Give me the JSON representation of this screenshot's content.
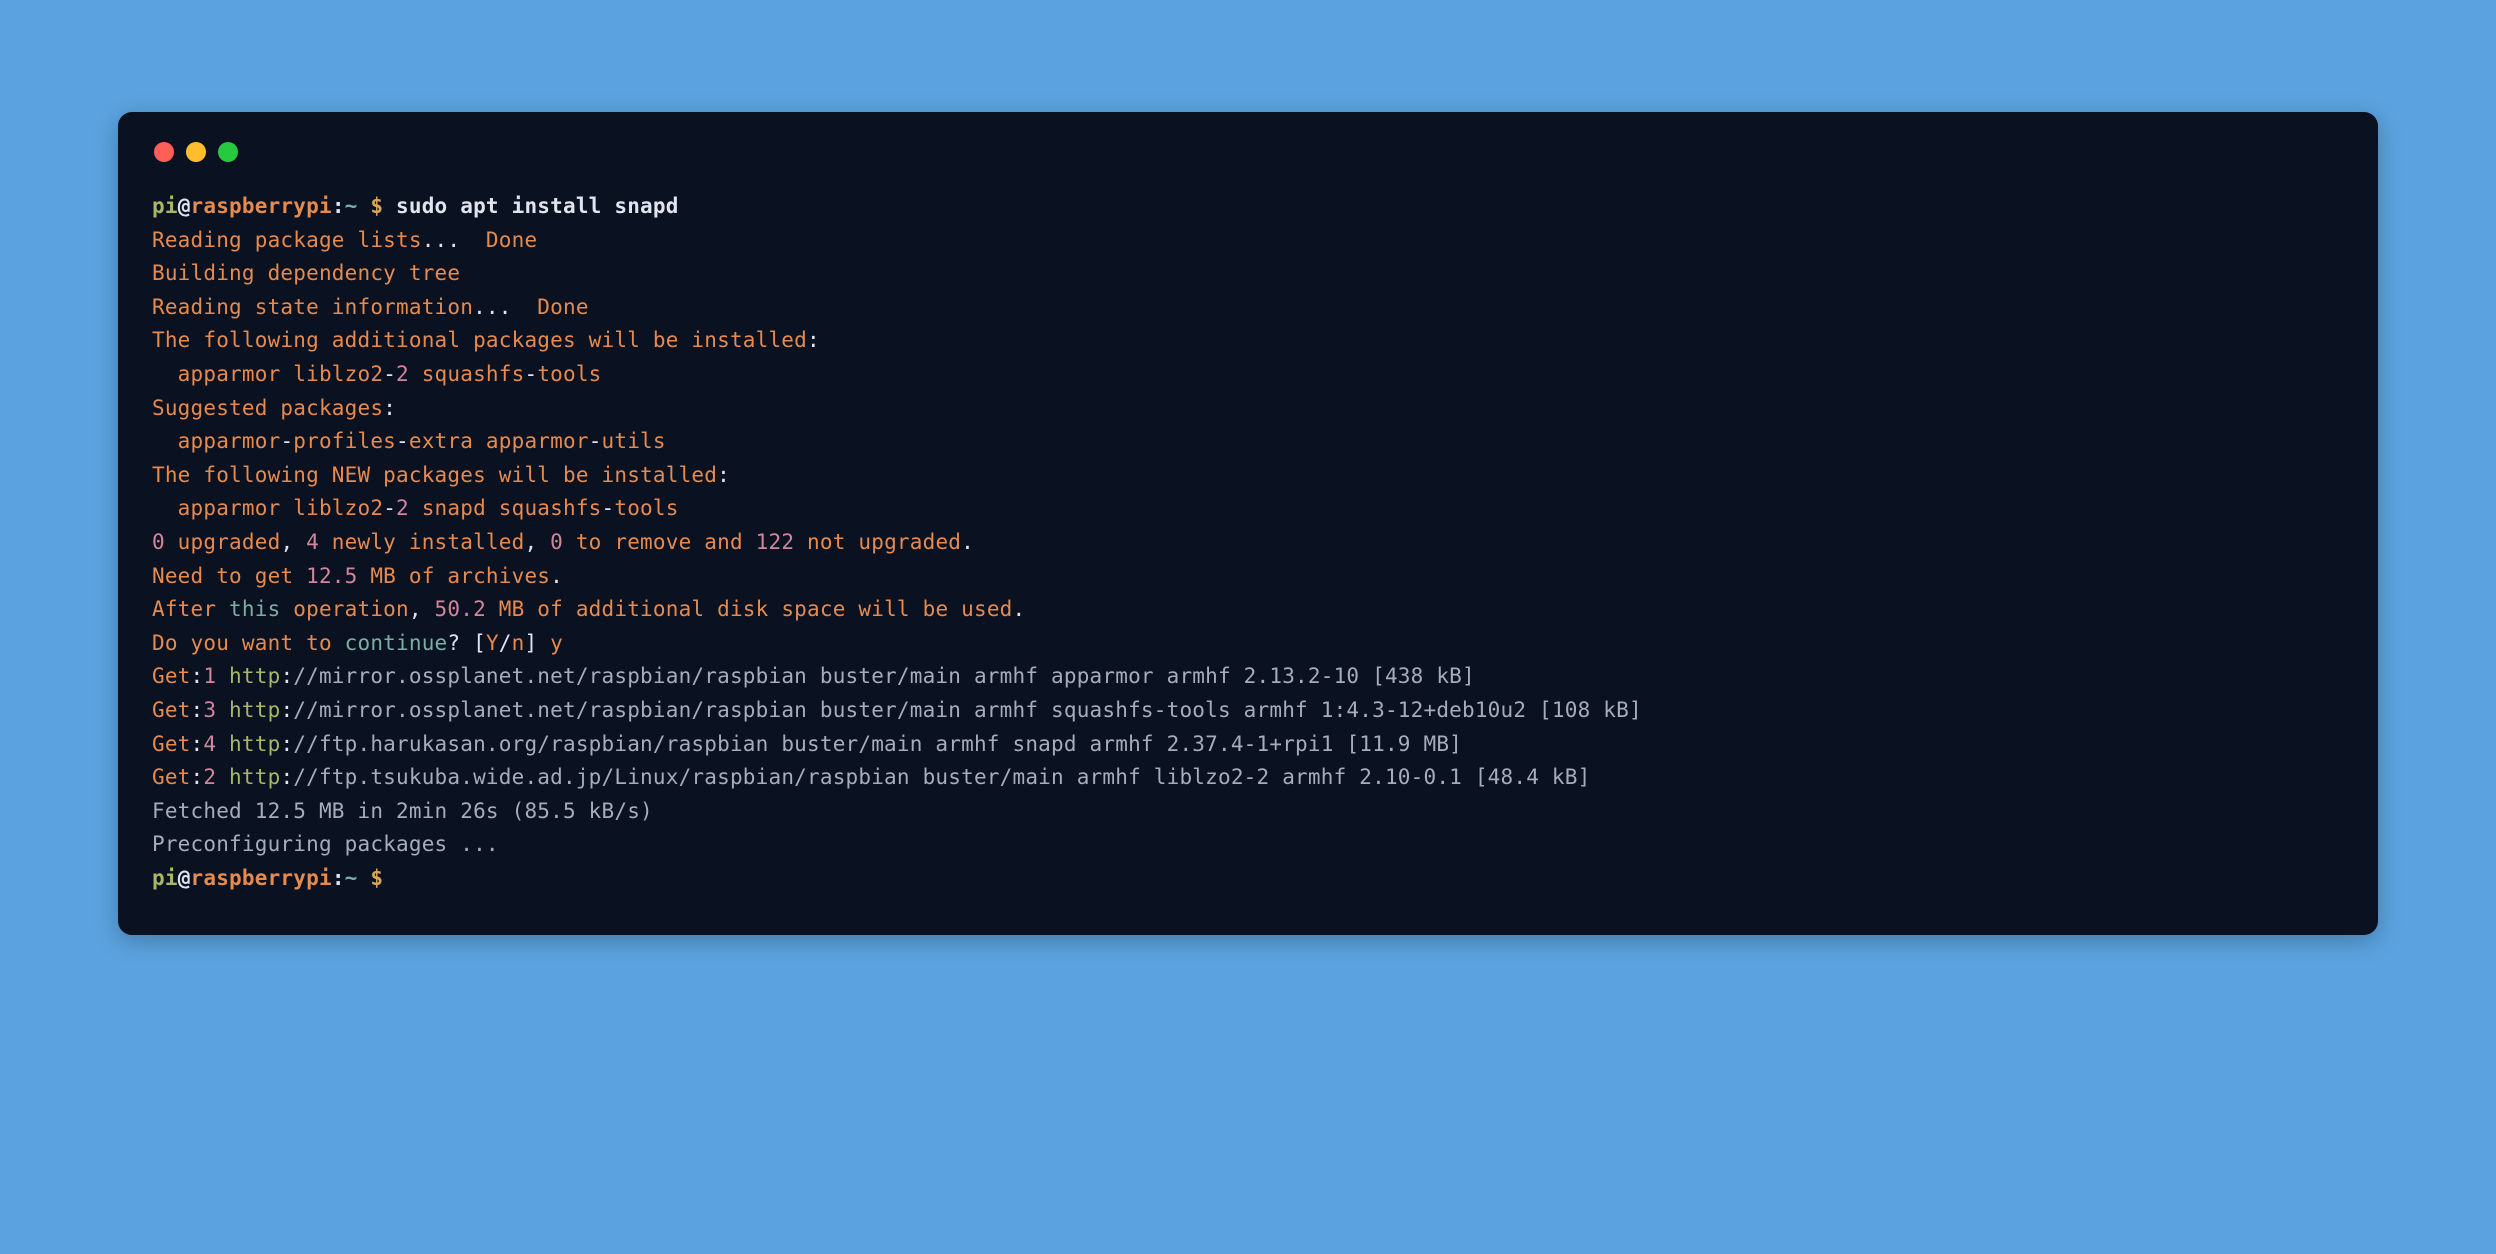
{
  "prompt": {
    "user": "pi",
    "at": "@",
    "host": "raspberrypi",
    "colon": ":",
    "path": "~",
    "symbol": "$"
  },
  "command": "sudo apt install snapd",
  "lines": {
    "l1a": "Reading package lists",
    "l1b": "...",
    "l1c": "  Done",
    "l2": "Building dependency tree",
    "l3a": "Reading state information",
    "l3b": "...",
    "l3c": "  Done",
    "l4a": "The following additional packages will be installed",
    "l4b": ":",
    "l5a": "  apparmor liblzo2",
    "l5m": "-",
    "l5b": "2",
    "l5c": " squashfs",
    "l5d": "-",
    "l5e": "tools",
    "l6a": "Suggested packages",
    "l6b": ":",
    "l7a": "  apparmor",
    "l7b": "-",
    "l7c": "profiles",
    "l7d": "-",
    "l7e": "extra apparmor",
    "l7f": "-",
    "l7g": "utils",
    "l8a": "The following NEW packages will be installed",
    "l8b": ":",
    "l9a": "  apparmor liblzo2",
    "l9m": "-",
    "l9b": "2",
    "l9c": " snapd squashfs",
    "l9d": "-",
    "l9e": "tools",
    "l10a": "0",
    "l10b": " upgraded",
    "l10c": ",",
    "l10d": " 4",
    "l10e": " newly installed",
    "l10f": ",",
    "l10g": " 0",
    "l10h": " to remove and",
    "l10i": " 122",
    "l10j": " not upgraded",
    "l10k": ".",
    "l11a": "Need",
    "l11b": " to get",
    "l11c": " 12.5",
    "l11d": " MB of archives",
    "l11e": ".",
    "l12a": "After",
    "l12b": " this",
    "l12c": " operation",
    "l12d": ",",
    "l12e": " 50.2",
    "l12f": " MB of additional disk space will be used",
    "l12g": ".",
    "l13a": "Do",
    "l13b": " you want to",
    "l13c": " continue",
    "l13d": "?",
    "l13e": " [",
    "l13f": "Y",
    "l13g": "/",
    "l13h": "n",
    "l13i": "]",
    "l13j": " y",
    "g1a": "Get",
    "g1b": ":",
    "g1c": "1",
    "g1d": " http",
    "g1e": ":",
    "g1f": "//mirror.ossplanet.net/raspbian/raspbian buster/main armhf apparmor armhf 2.13.2-10 [438 kB]",
    "g3a": "Get",
    "g3b": ":",
    "g3c": "3",
    "g3d": " http",
    "g3e": ":",
    "g3f": "//mirror.ossplanet.net/raspbian/raspbian buster/main armhf squashfs-tools armhf 1:4.3-12+deb10u2 [108 kB]",
    "g4a": "Get",
    "g4b": ":",
    "g4c": "4",
    "g4d": " http",
    "g4e": ":",
    "g4f": "//ftp.harukasan.org/raspbian/raspbian buster/main armhf snapd armhf 2.37.4-1+rpi1 [11.9 MB]",
    "g2a": "Get",
    "g2b": ":",
    "g2c": "2",
    "g2d": " http",
    "g2e": ":",
    "g2f": "//ftp.tsukuba.wide.ad.jp/Linux/raspbian/raspbian buster/main armhf liblzo2-2 armhf 2.10-0.1 [48.4 kB]",
    "f1": "Fetched 12.5 MB in 2min 26s (85.5 kB/s)",
    "f2": "Preconfiguring packages ..."
  }
}
